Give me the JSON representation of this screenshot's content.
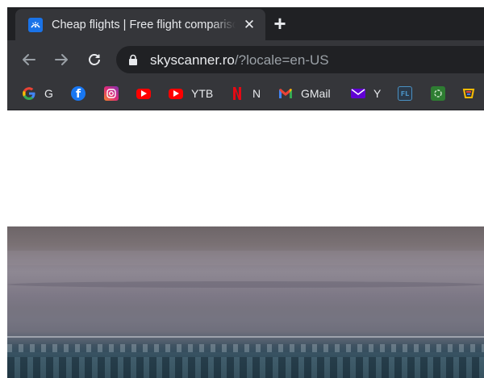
{
  "tab": {
    "title": "Cheap flights | Free flight comparison",
    "close": "✕"
  },
  "toolbar": {
    "new_tab": "+"
  },
  "address": {
    "host": "skyscanner.ro",
    "rest": "/?locale=en-US"
  },
  "bookmarks": [
    {
      "label": "G",
      "icon": "google-icon"
    },
    {
      "label": "",
      "icon": "facebook-icon"
    },
    {
      "label": "",
      "icon": "instagram-icon"
    },
    {
      "label": "",
      "icon": "youtube-icon"
    },
    {
      "label": "YTB",
      "icon": "youtube-icon"
    },
    {
      "label": "N",
      "icon": "netflix-icon"
    },
    {
      "label": "GMail",
      "icon": "gmail-icon"
    },
    {
      "label": "Y",
      "icon": "yahoo-mail-icon"
    },
    {
      "label": "",
      "icon": "fl-icon"
    },
    {
      "label": "",
      "icon": "green-circle-icon"
    },
    {
      "label": "",
      "icon": "extension-icon"
    }
  ],
  "colors": {
    "tabstrip": "#202124",
    "toolbar": "#35363a",
    "text": "#e8eaed",
    "url_dim": "#9aa0a6"
  }
}
